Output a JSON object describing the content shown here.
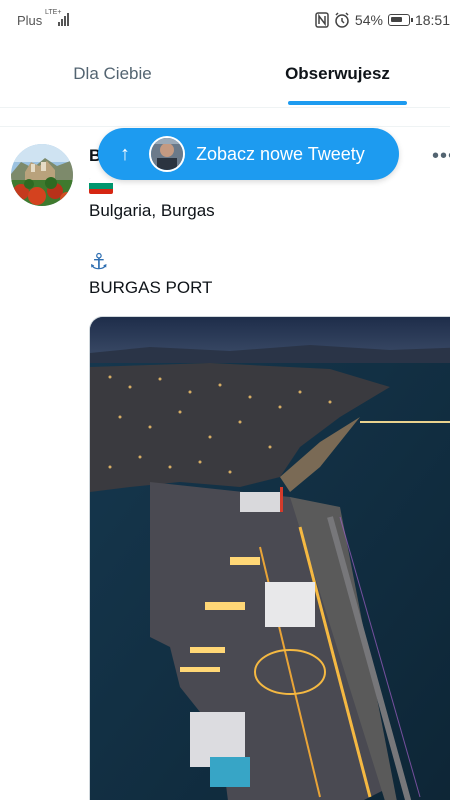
{
  "status_bar": {
    "carrier": "Plus",
    "network": "LTE+",
    "battery": "54%",
    "time": "18:51"
  },
  "tabs": [
    {
      "label": "Dla Ciebie",
      "active": false
    },
    {
      "label": "Obserwujesz",
      "active": true
    }
  ],
  "new_tweets": {
    "label": "Zobacz nowe Tweety"
  },
  "tweet": {
    "author_initial": "B",
    "location_text": "Bulgaria, Burgas",
    "anchor_icon": "anchor-icon",
    "port_text": "BURGAS PORT",
    "flag": "bulgaria-flag"
  },
  "colors": {
    "accent": "#1d9bf0",
    "tab_inactive": "#536471",
    "text": "#0f1419"
  }
}
